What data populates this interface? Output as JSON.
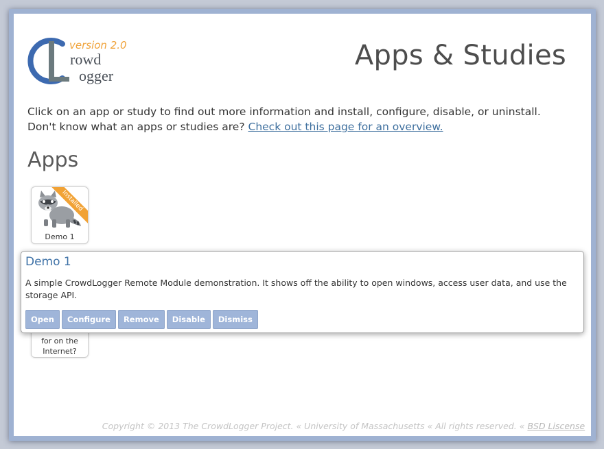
{
  "logo": {
    "version": "version 2.0",
    "rowd": "rowd",
    "ogger": "ogger"
  },
  "page_title": "Apps & Studies",
  "intro": {
    "text": "Click on an app or study to find out more information and install, configure, disable, or uninstall. Don't know what an apps or studies are?",
    "link_text": "Check out this page for an overview."
  },
  "apps_section": {
    "title": "Apps"
  },
  "apps": [
    {
      "label": "Demo 1",
      "ribbon": "Installed",
      "icon": "raccoon-icon"
    }
  ],
  "study_tile": {
    "line1": "for on the",
    "line2": "Internet?"
  },
  "popup": {
    "title": "Demo 1",
    "description": "A simple CrowdLogger Remote Module demonstration. It shows off the ability to open windows, access user data, and use the storage API.",
    "buttons": [
      "Open",
      "Configure",
      "Remove",
      "Disable",
      "Dismiss"
    ]
  },
  "footer": {
    "text": "Copyright © 2013 The CrowdLogger Project. « University of Massachusetts « All rights reserved. «",
    "link_text": "BSD Liscense"
  },
  "colors": {
    "accent_blue": "#3f72a7",
    "button_blue": "#9fb5d9",
    "ribbon_orange": "#f1a235"
  }
}
